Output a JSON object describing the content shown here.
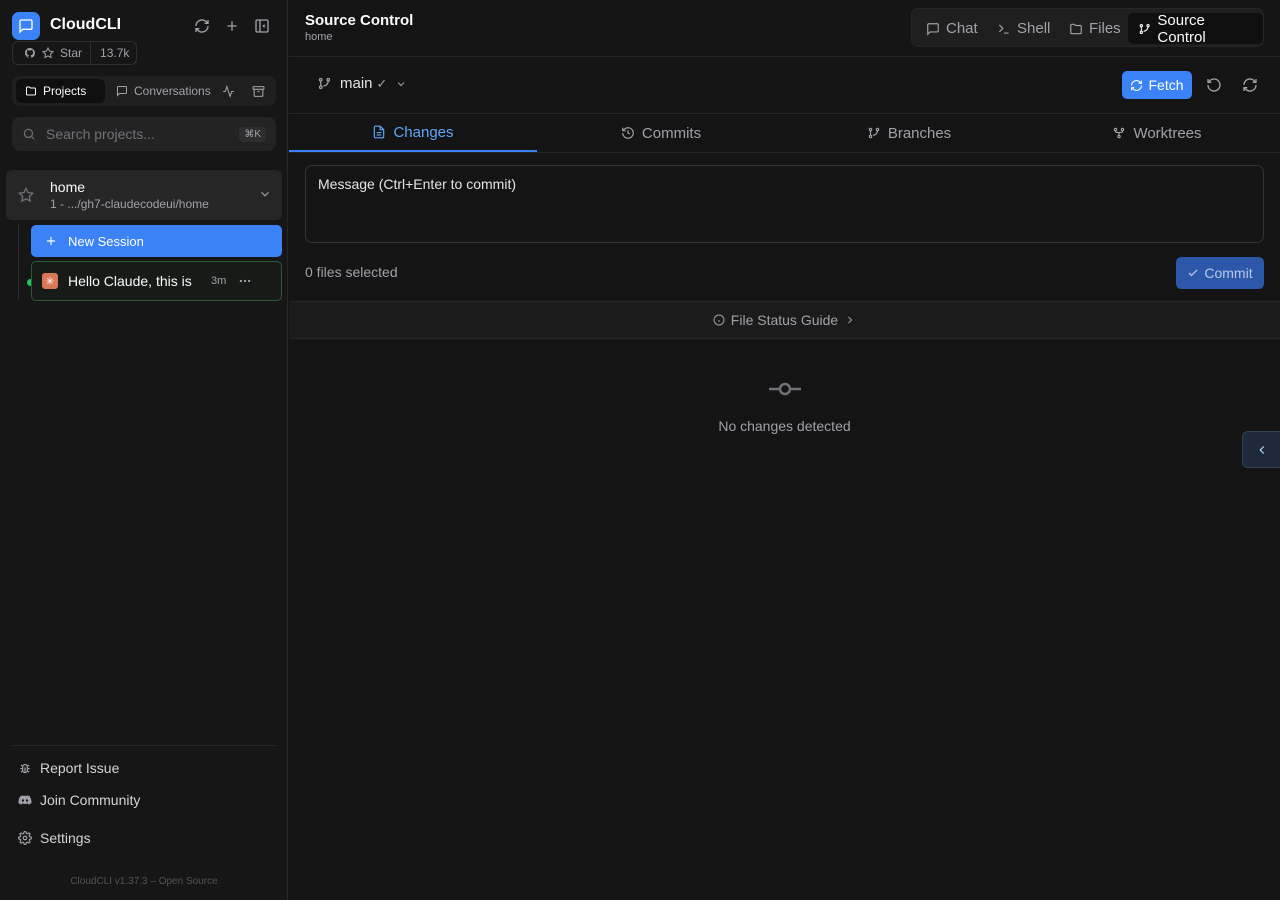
{
  "app": {
    "name": "CloudCLI",
    "stars_label": "Star",
    "stars_count": "13.7k"
  },
  "sidebar": {
    "tabs": [
      {
        "label": "Projects"
      },
      {
        "label": "Conversations"
      }
    ],
    "search": {
      "placeholder": "Search projects...",
      "shortcut": "⌘K"
    },
    "project": {
      "name": "home",
      "count": "1",
      "path": "- .../gh7-claudecodeui/home"
    },
    "new_session_label": "New Session",
    "session": {
      "title": "Hello Claude, this is",
      "time": "3m"
    },
    "footer": {
      "report_issue": "Report Issue",
      "join_community": "Join Community",
      "settings": "Settings",
      "version": "CloudCLI v1.37.3 – Open Source"
    }
  },
  "header": {
    "title": "Source Control",
    "subtitle": "home"
  },
  "top_nav": [
    {
      "label": "Chat",
      "icon": "chat-icon"
    },
    {
      "label": "Shell",
      "icon": "terminal-icon"
    },
    {
      "label": "Files",
      "icon": "folder-icon"
    },
    {
      "label": "Source Control",
      "icon": "git-branch-icon",
      "active": true
    }
  ],
  "toolbar": {
    "branch": "main",
    "branch_status": "✓",
    "fetch_label": "Fetch"
  },
  "sc_tabs": [
    {
      "label": "Changes",
      "active": true
    },
    {
      "label": "Commits"
    },
    {
      "label": "Branches"
    },
    {
      "label": "Worktrees"
    }
  ],
  "commit": {
    "placeholder": "Message (Ctrl+Enter to commit)",
    "files_selected": "0 files selected",
    "button_label": "Commit"
  },
  "guide_label": "File Status Guide",
  "empty_state": "No changes detected",
  "colors": {
    "accent": "#3b82f6",
    "online": "#22c55e",
    "claude": "#d97757"
  }
}
